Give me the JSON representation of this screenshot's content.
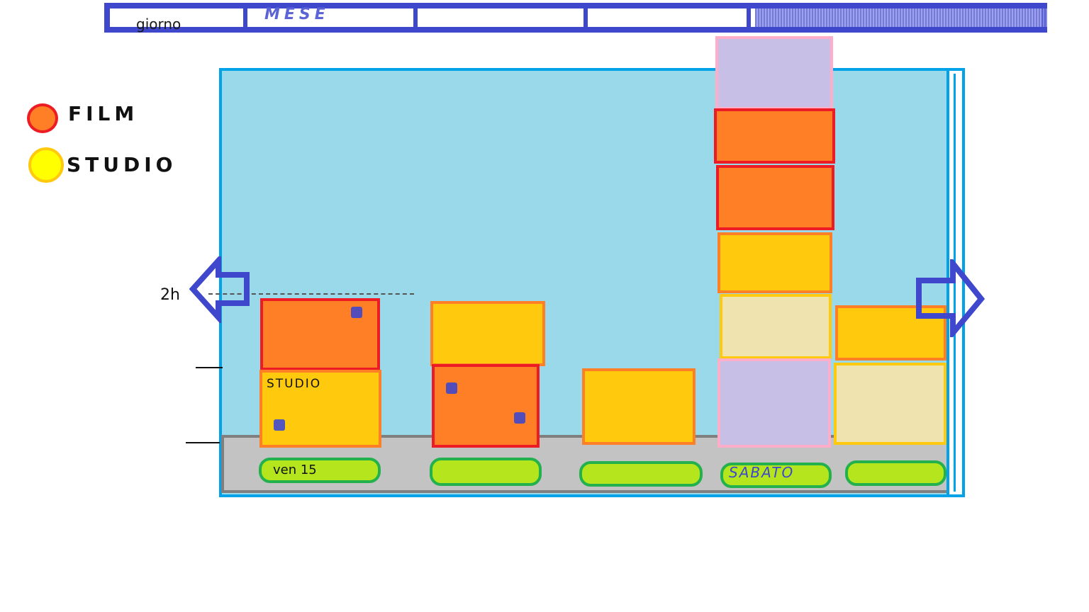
{
  "tabs": {
    "giorno": "giorno",
    "mese": "MESE"
  },
  "legend": [
    {
      "label": "FILM",
      "color": "#ff7f27"
    },
    {
      "label": "STUDIO",
      "color": "#ffff00"
    }
  ],
  "axis": {
    "label_2h": "2h"
  },
  "columns": [
    {
      "day": "ven 15",
      "blocks": [
        {
          "type": "film"
        },
        {
          "type": "studio",
          "label": "STUDIO"
        }
      ]
    },
    {
      "day": "",
      "blocks": [
        {
          "type": "studio"
        },
        {
          "type": "film"
        }
      ]
    },
    {
      "day": "",
      "blocks": [
        {
          "type": "studio"
        }
      ]
    },
    {
      "day": "SABATO",
      "blocks": [
        {
          "type": "lavender"
        },
        {
          "type": "film"
        },
        {
          "type": "film"
        },
        {
          "type": "studio"
        },
        {
          "type": "cream"
        },
        {
          "type": "lavender"
        }
      ]
    },
    {
      "day": "",
      "blocks": [
        {
          "type": "studio"
        },
        {
          "type": "cream"
        }
      ]
    }
  ],
  "colors": {
    "accent": "#3f48cc",
    "chart_bg": "#99d9ea",
    "chart_border": "#00a2e8",
    "film": "#ff7f27",
    "studio": "#ffc90e",
    "day_pill": "#b5e61d"
  },
  "icons": {
    "prev": "arrow-left-icon",
    "next": "arrow-right-icon"
  }
}
